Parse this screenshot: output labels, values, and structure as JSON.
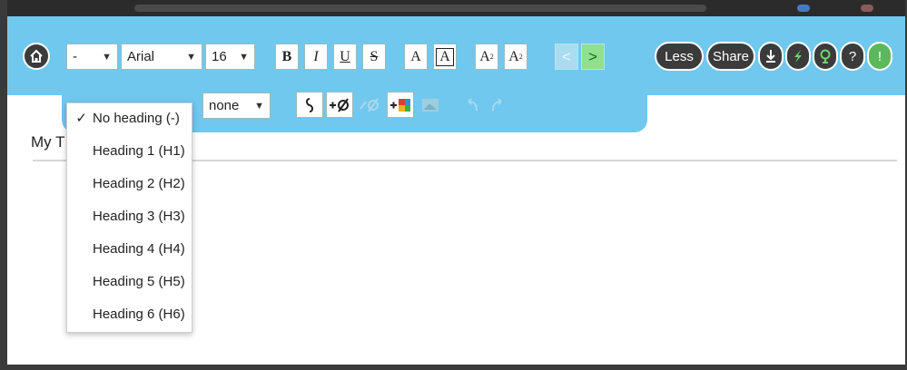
{
  "colors": {
    "toolbar": "#70c8ee",
    "dark_button": "#3b3b3b",
    "green_button": "#5cb85c",
    "disabled_icon": "#a8d8ee"
  },
  "toolbar": {
    "heading_select": {
      "value": "-"
    },
    "font_select": {
      "value": "Arial"
    },
    "size_select": {
      "value": "16"
    },
    "format_buttons": {
      "bold": "B",
      "italic": "I",
      "underline": "U",
      "strike": "S",
      "font_color": "A",
      "highlight": "A",
      "superscript": "A",
      "superscript_mark": "2",
      "subscript": "A",
      "subscript_mark": "2"
    },
    "nav": {
      "prev": "<",
      "next": ">"
    },
    "right": {
      "less": "Less",
      "share": "Share",
      "help": "?",
      "alert": "!"
    },
    "row2": {
      "style_select": {
        "value": "none"
      }
    }
  },
  "document": {
    "title": "My T"
  },
  "heading_menu": {
    "items": [
      {
        "label": "No heading (-)",
        "checked": "✓"
      },
      {
        "label": "Heading 1 (H1)",
        "checked": ""
      },
      {
        "label": "Heading 2 (H2)",
        "checked": ""
      },
      {
        "label": "Heading 3 (H3)",
        "checked": ""
      },
      {
        "label": "Heading 4 (H4)",
        "checked": ""
      },
      {
        "label": "Heading 5 (H5)",
        "checked": ""
      },
      {
        "label": "Heading 6 (H6)",
        "checked": ""
      }
    ]
  },
  "icons": {
    "home": "home-icon",
    "link": "link-icon",
    "add_link": "add-link-icon",
    "remove_link": "remove-link-icon",
    "add_image": "add-image-icon",
    "image": "image-icon",
    "undo": "undo-icon",
    "redo": "redo-icon",
    "download": "download-icon",
    "lightning": "lightning-icon",
    "tree": "tree-icon"
  }
}
